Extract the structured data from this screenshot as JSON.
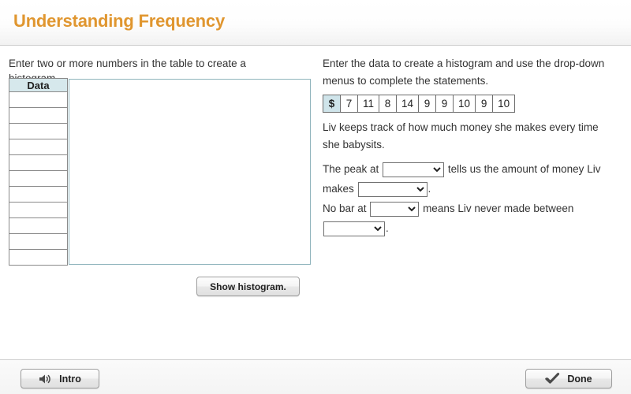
{
  "header": {
    "title": "Understanding Frequency",
    "title_color": "#e0962f"
  },
  "left_panel": {
    "instruction": "Enter two or more numbers in the table to create a histogram.",
    "table": {
      "column_header": "Data",
      "rows": [
        "",
        "",
        "",
        "",
        "",
        "",
        "",
        "",
        "",
        "",
        ""
      ]
    },
    "show_histogram_button": "Show histogram."
  },
  "right_panel": {
    "instruction": "Enter the data to create a histogram and use the drop-down menus to complete the statements.",
    "values_table": {
      "unit_label": "$",
      "values": [
        "7",
        "11",
        "8",
        "14",
        "9",
        "9",
        "10",
        "9",
        "10"
      ],
      "unit_cell_color": "#cfe4ea"
    },
    "context_sentence": "Liv keeps track of how much money she makes every time she babysits.",
    "statement_1": {
      "part_1": "The peak at",
      "dropdown_1_value": "",
      "part_2": "tells us the amount of money",
      "part_3": "Liv makes",
      "dropdown_2_value": "",
      "part_4": "."
    },
    "statement_2": {
      "part_1": "No bar at",
      "dropdown_1_value": "",
      "part_2": "means Liv never made between",
      "dropdown_2_value": "",
      "part_3": "."
    }
  },
  "footer": {
    "intro_button": "Intro",
    "intro_icon": "speaker-icon",
    "done_button": "Done",
    "done_icon": "checkmark-icon"
  }
}
